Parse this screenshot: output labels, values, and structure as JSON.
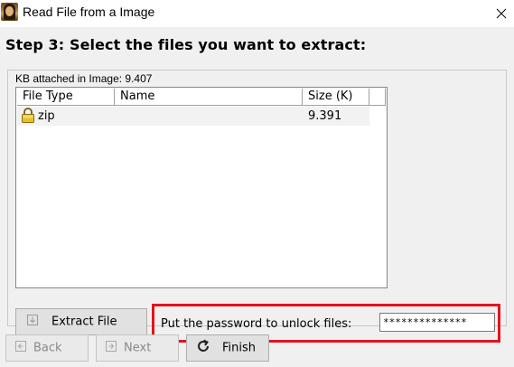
{
  "window": {
    "title": "Read File from a Image",
    "app_icon": "mona-lisa-icon",
    "close_icon": "close-icon"
  },
  "step": {
    "title": "Step 3: Select the files you want to extract:"
  },
  "attachment": {
    "kb_label": "KB attached in Image: 9.407"
  },
  "file_list": {
    "columns": [
      "File Type",
      "Name",
      "Size (K)"
    ],
    "rows": [
      {
        "type": "zip",
        "name": "",
        "size": "9.391",
        "icon": "lock-icon"
      }
    ]
  },
  "actions": {
    "extract_label": "Extract File",
    "password_prompt": "Put the password to unlock files:",
    "password_value": "**************",
    "highlight_color": "#e0141e"
  },
  "wizard": {
    "back_label": "Back",
    "next_label": "Next",
    "finish_label": "Finish"
  }
}
